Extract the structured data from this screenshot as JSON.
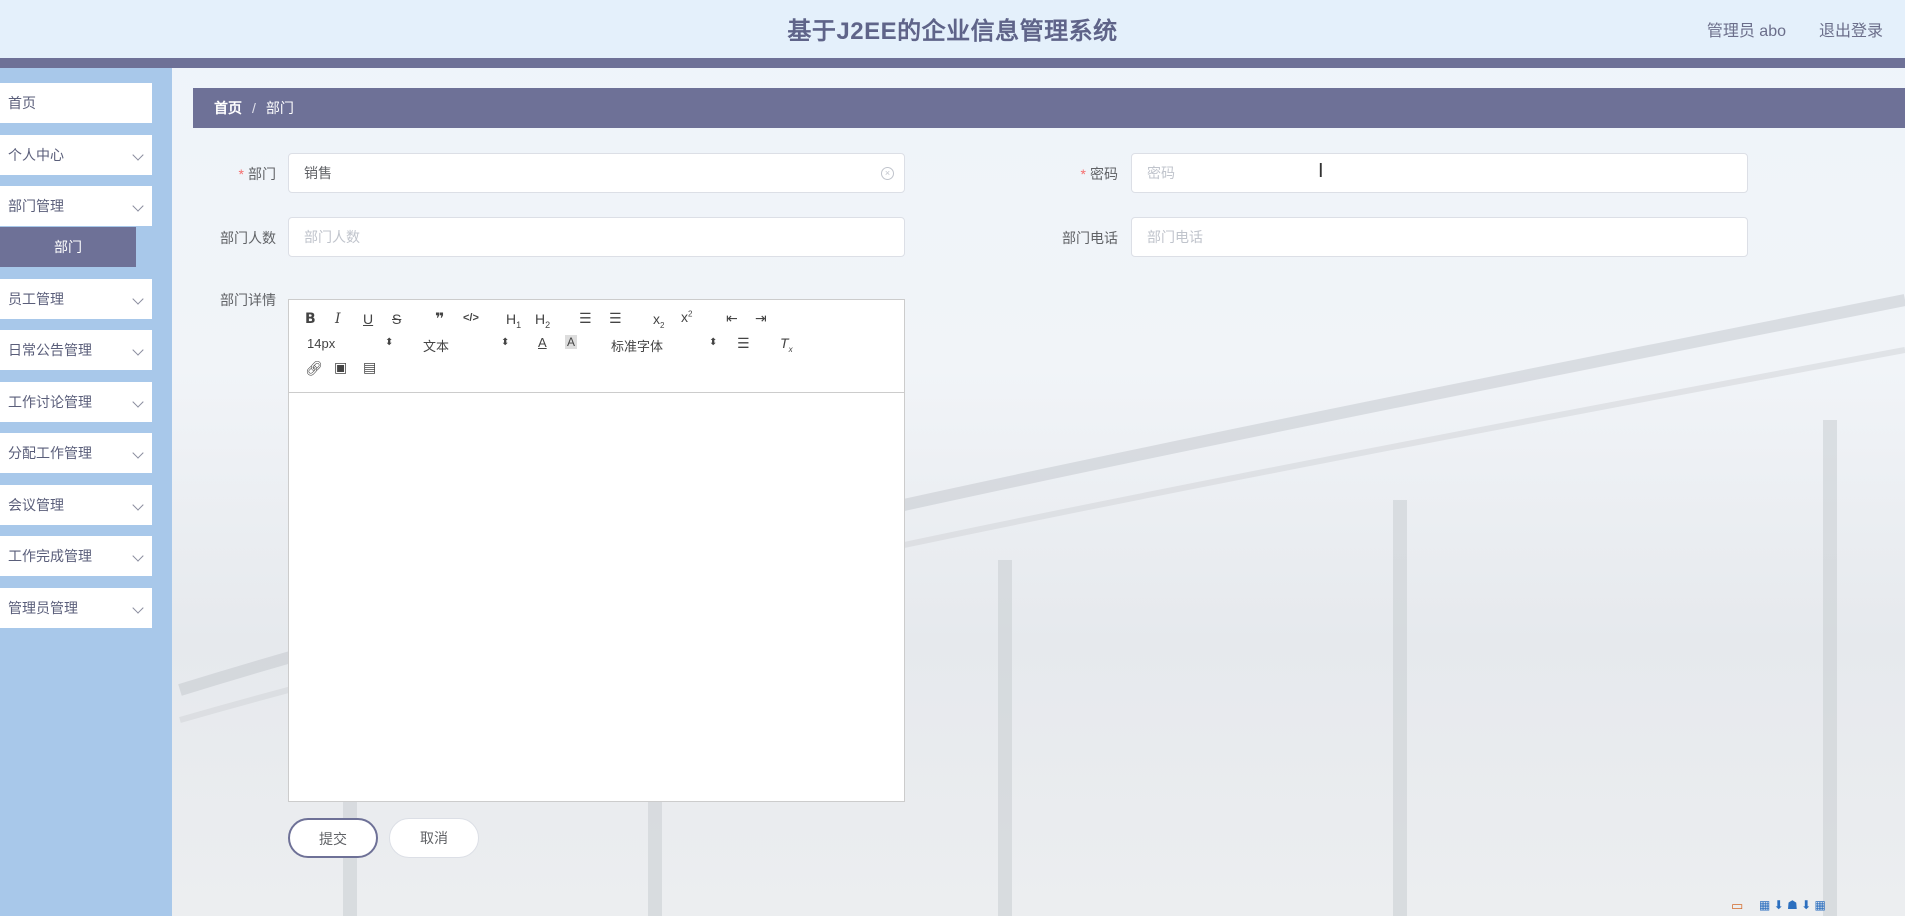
{
  "header": {
    "title": "基于J2EE的企业信息管理系统",
    "user": "管理员 abo",
    "logout": "退出登录"
  },
  "sidebar": {
    "items": [
      {
        "label": "首页",
        "expandable": false
      },
      {
        "label": "个人中心",
        "expandable": true
      },
      {
        "label": "部门管理",
        "expandable": true
      },
      {
        "label": "员工管理",
        "expandable": true
      },
      {
        "label": "日常公告管理",
        "expandable": true
      },
      {
        "label": "工作讨论管理",
        "expandable": true
      },
      {
        "label": "分配工作管理",
        "expandable": true
      },
      {
        "label": "会议管理",
        "expandable": true
      },
      {
        "label": "工作完成管理",
        "expandable": true
      },
      {
        "label": "管理员管理",
        "expandable": true
      }
    ],
    "active_sub": "部门"
  },
  "breadcrumb": {
    "home": "首页",
    "separator": "/",
    "current": "部门"
  },
  "form": {
    "department_label": "部门",
    "department_value": "销售",
    "password_label": "密码",
    "password_placeholder": "密码",
    "count_label": "部门人数",
    "count_placeholder": "部门人数",
    "phone_label": "部门电话",
    "phone_placeholder": "部门电话",
    "detail_label": "部门详情",
    "required_mark": "*"
  },
  "editor": {
    "font_size": "14px",
    "block_format": "文本",
    "font_family": "标准字体"
  },
  "buttons": {
    "submit": "提交",
    "cancel": "取消"
  },
  "colors": {
    "accent": "#6e7197",
    "sidebar_bg": "#a8c8ea",
    "header_bg": "#e4f0fb",
    "required": "#f56c6c"
  }
}
